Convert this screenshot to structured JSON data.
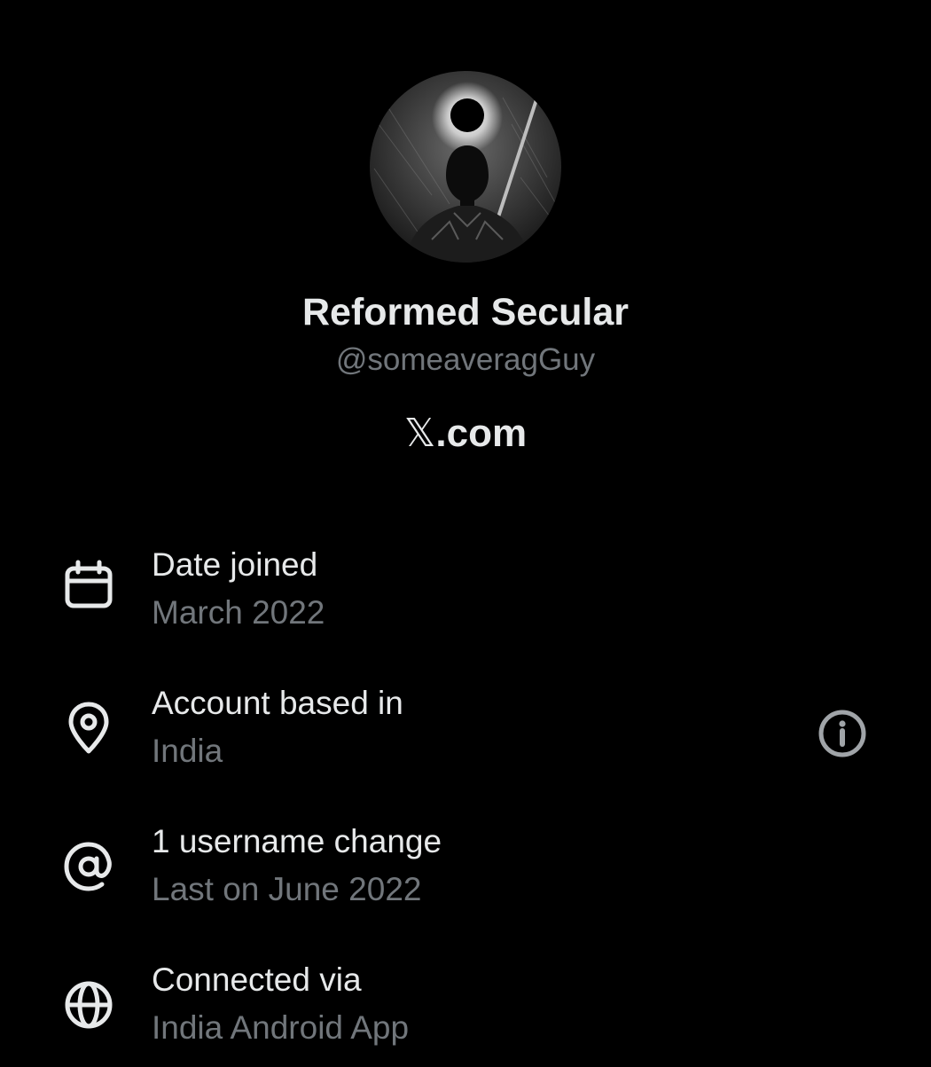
{
  "profile": {
    "display_name": "Reformed Secular",
    "handle": "@someaveragGuy",
    "avatar_icon": "eclipse-warrior-avatar"
  },
  "brand": {
    "x_glyph": "𝕏",
    "suffix": ".com"
  },
  "about": {
    "rows": [
      {
        "icon": "calendar-icon",
        "title": "Date joined",
        "value": "March 2022"
      },
      {
        "icon": "location-pin-icon",
        "title": "Account based in",
        "value": "India",
        "trailing_icon": "info-icon"
      },
      {
        "icon": "at-sign-icon",
        "title": "1 username change",
        "value": "Last on June 2022"
      },
      {
        "icon": "globe-icon",
        "title": "Connected via",
        "value": "India Android App"
      }
    ]
  },
  "colors": {
    "background": "#000000",
    "primary_text": "#e7e9ea",
    "secondary_text": "#71767b"
  }
}
